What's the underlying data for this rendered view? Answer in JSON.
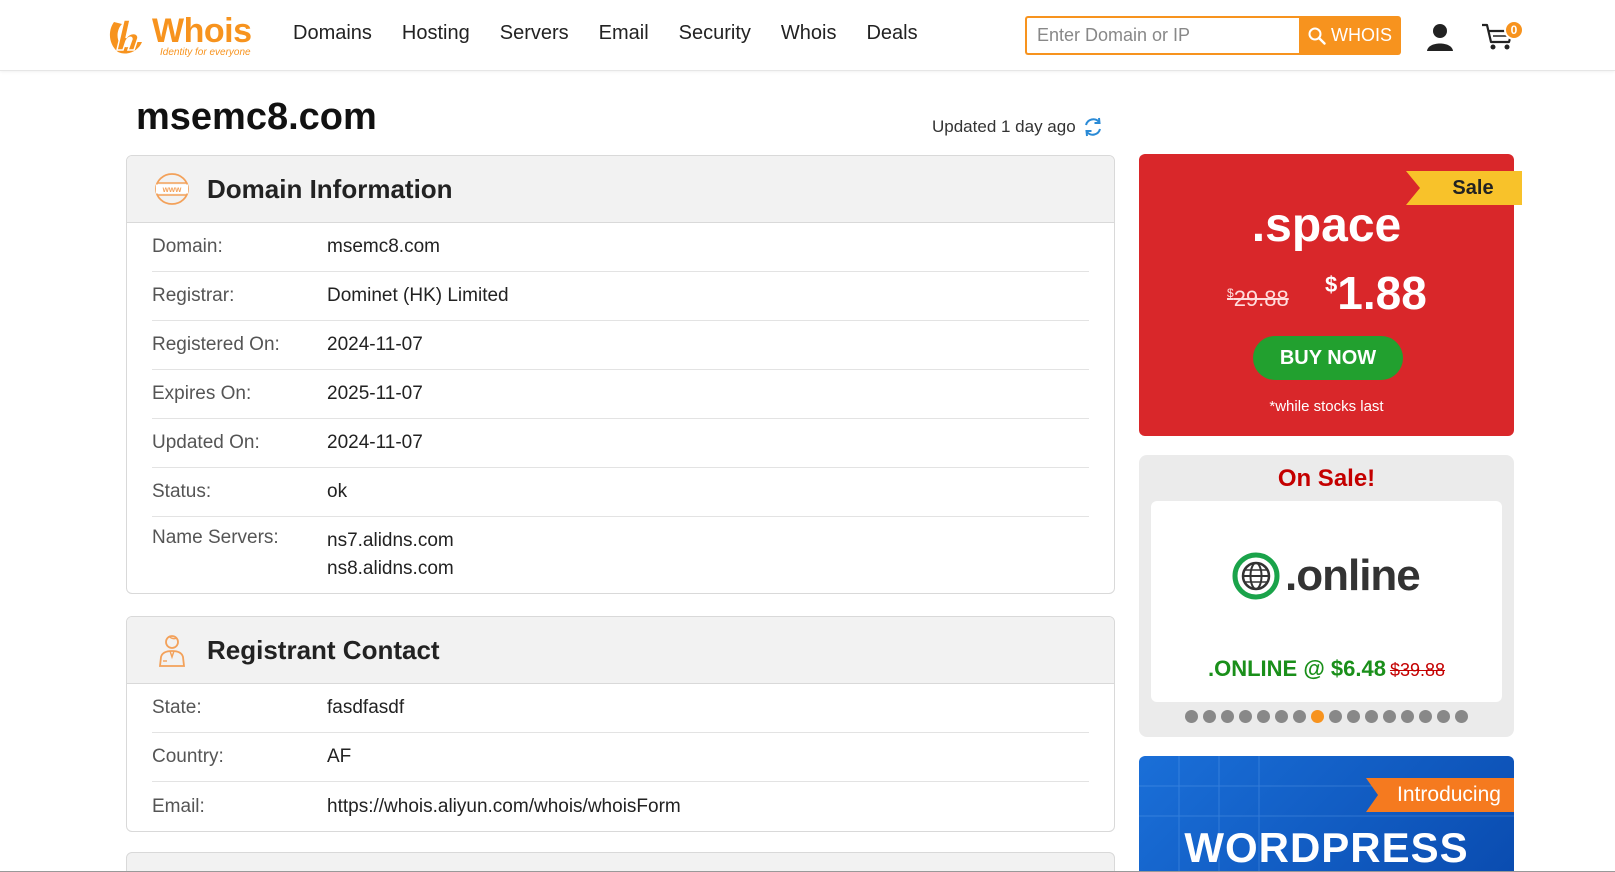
{
  "header": {
    "logo_word": "Whois",
    "logo_tagline": "Identity for everyone",
    "nav": [
      "Domains",
      "Hosting",
      "Servers",
      "Email",
      "Security",
      "Whois",
      "Deals"
    ],
    "search_placeholder": "Enter Domain or IP",
    "search_button": "WHOIS",
    "cart_count": "0",
    "accent": "#f7931e"
  },
  "page": {
    "title": "msemc8.com",
    "updated": "Updated 1 day ago"
  },
  "domain_info": {
    "title": "Domain Information",
    "rows": [
      {
        "label": "Domain:",
        "value": "msemc8.com"
      },
      {
        "label": "Registrar:",
        "value": "Dominet (HK) Limited"
      },
      {
        "label": "Registered On:",
        "value": "2024-11-07"
      },
      {
        "label": "Expires On:",
        "value": "2025-11-07"
      },
      {
        "label": "Updated On:",
        "value": "2024-11-07"
      },
      {
        "label": "Status:",
        "value": "ok"
      }
    ],
    "name_servers_label": "Name Servers:",
    "name_servers": [
      "ns7.alidns.com",
      "ns8.alidns.com"
    ]
  },
  "registrant": {
    "title": "Registrant Contact",
    "rows": [
      {
        "label": "State:",
        "value": "fasdfasdf"
      },
      {
        "label": "Country:",
        "value": "AF"
      },
      {
        "label": "Email:",
        "value": "https://whois.aliyun.com/whois/whoisForm"
      }
    ]
  },
  "promo_sale": {
    "ribbon": "Sale",
    "tld": ".space",
    "old_currency": "$",
    "old_price": "29.88",
    "new_currency": "$",
    "new_price": "1.88",
    "button": "BUY NOW",
    "note": "*while stocks last",
    "bg": "#d9272a"
  },
  "on_sale": {
    "title": "On Sale!",
    "logo_word": ".online",
    "price_text": ".ONLINE @ $6.48",
    "old_price": "$39.88",
    "dot_count": 16,
    "active_dot": 7
  },
  "wp_banner": {
    "ribbon": "Introducing",
    "text": "WORDPRESS"
  }
}
